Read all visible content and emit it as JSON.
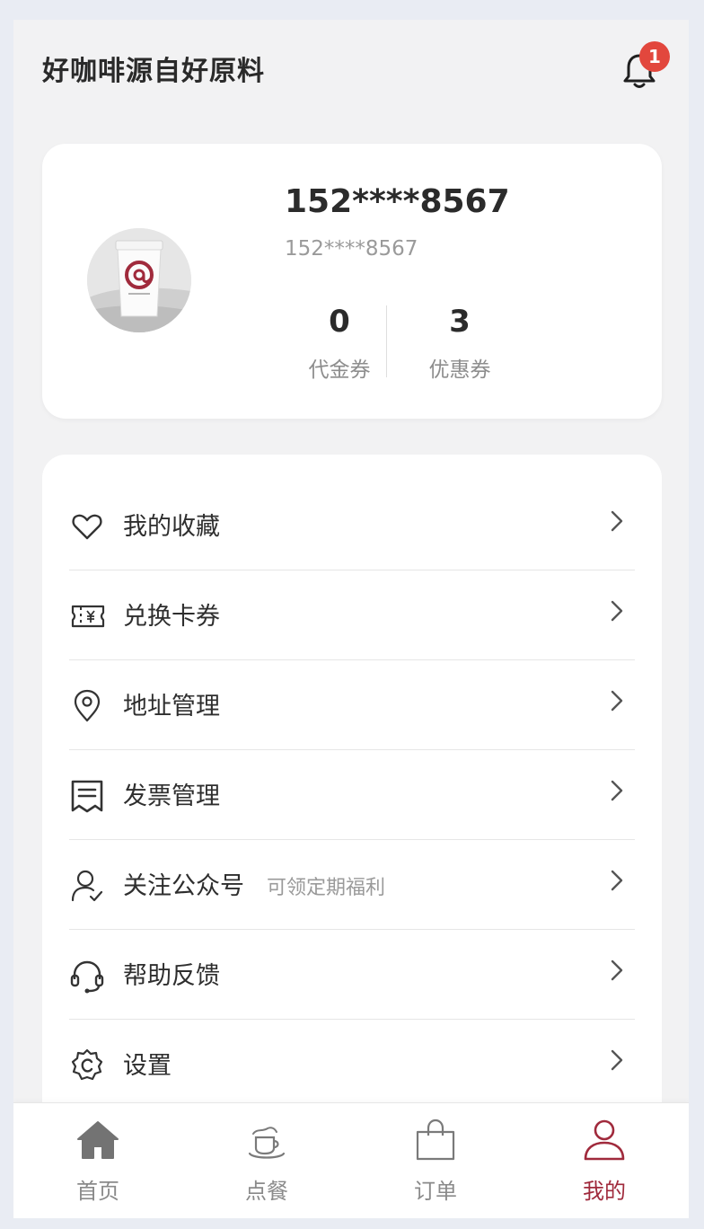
{
  "header": {
    "title": "好咖啡源自好原料",
    "notification_count": "1"
  },
  "profile": {
    "name": "152****8567",
    "phone": "152****8567",
    "stats": [
      {
        "value": "0",
        "label": "代金券"
      },
      {
        "value": "3",
        "label": "优惠券"
      }
    ]
  },
  "menu": {
    "items": [
      {
        "label": "我的收藏",
        "icon": "heart-icon"
      },
      {
        "label": "兑换卡券",
        "icon": "ticket-icon"
      },
      {
        "label": "地址管理",
        "icon": "location-pin-icon"
      },
      {
        "label": "发票管理",
        "icon": "invoice-icon"
      },
      {
        "label": "关注公众号",
        "hint": "可领定期福利",
        "icon": "user-check-icon"
      },
      {
        "label": "帮助反馈",
        "icon": "headset-icon"
      },
      {
        "label": "设置",
        "icon": "settings-icon"
      }
    ]
  },
  "tabbar": {
    "tabs": [
      {
        "label": "首页",
        "icon": "home-icon"
      },
      {
        "label": "点餐",
        "icon": "coffee-cup-icon"
      },
      {
        "label": "订单",
        "icon": "shopping-bag-icon"
      },
      {
        "label": "我的",
        "icon": "profile-icon",
        "active": true
      }
    ]
  },
  "colors": {
    "accent": "#a02a3c",
    "badge": "#e2473d",
    "background": "#f2f2f3"
  }
}
